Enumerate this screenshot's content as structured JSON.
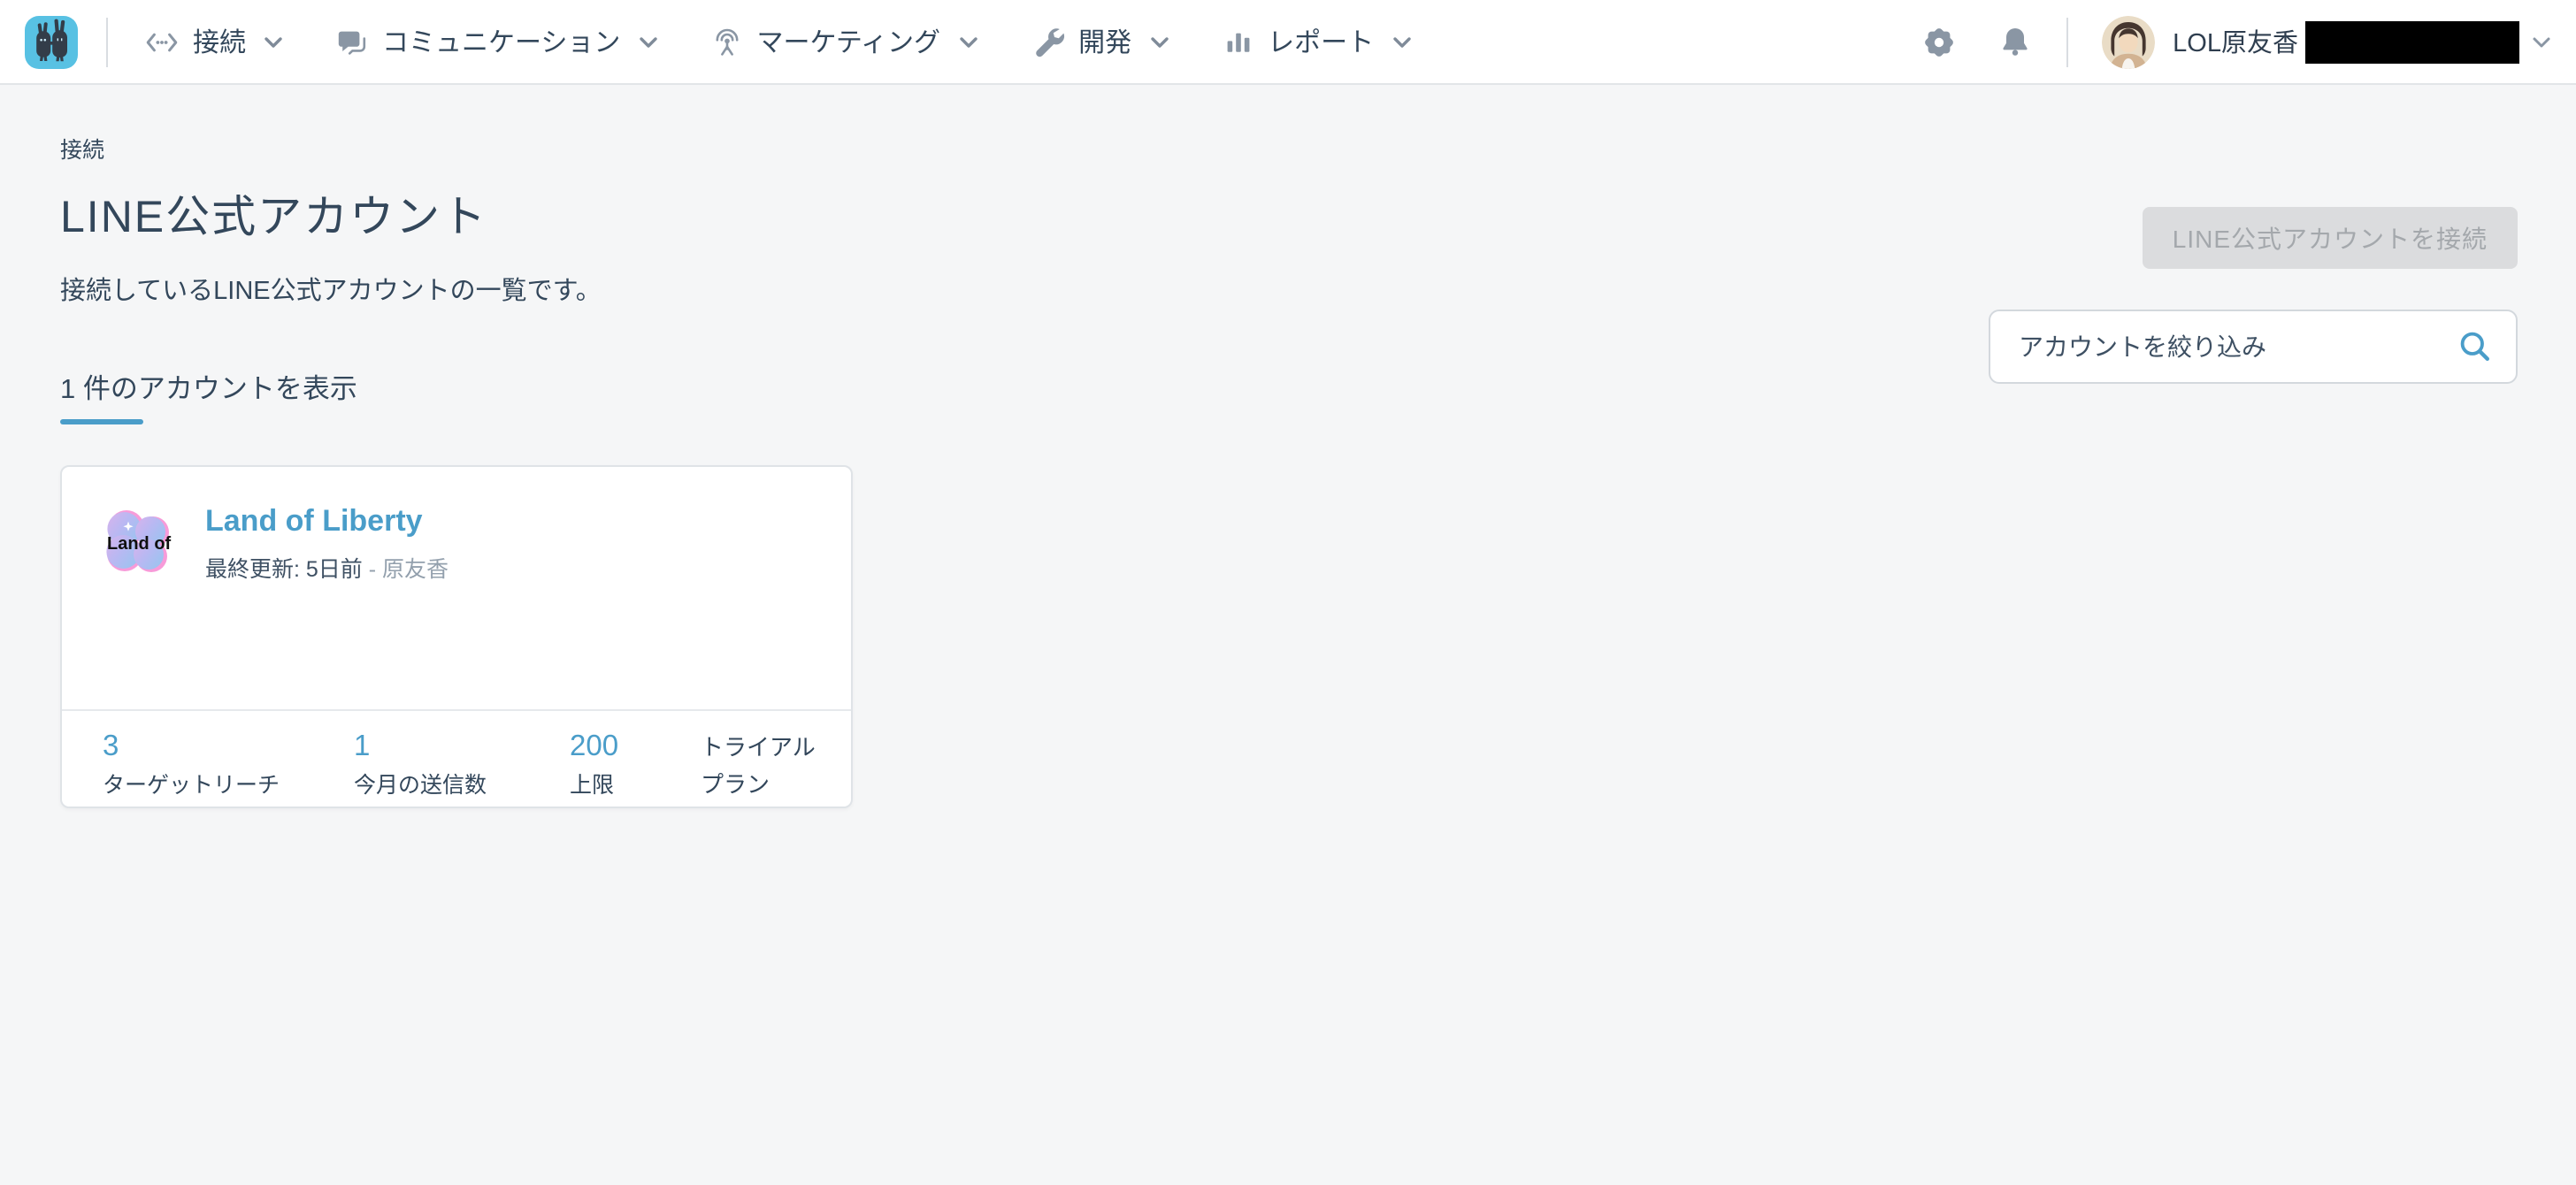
{
  "navbar": {
    "items": [
      {
        "label": "接続",
        "icon": "code-brackets-icon"
      },
      {
        "label": "コミュニケーション",
        "icon": "chat-bubble-icon"
      },
      {
        "label": "マーケティング",
        "icon": "broadcast-antenna-icon"
      },
      {
        "label": "開発",
        "icon": "wrench-icon"
      },
      {
        "label": "レポート",
        "icon": "bar-chart-icon"
      }
    ],
    "right_icons": [
      "gear-icon",
      "bell-icon"
    ],
    "user": {
      "name": "LOL原友香"
    }
  },
  "page": {
    "breadcrumb": "接続",
    "title": "LINE公式アカウント",
    "subtitle": "接続しているLINE公式アカウントの一覧です。",
    "connect_button": "LINE公式アカウントを接続",
    "tab_label": "1 件のアカウントを表示",
    "search_placeholder": "アカウントを絞り込み"
  },
  "account_card": {
    "avatar_text": "Land of",
    "name": "Land of Liberty",
    "last_updated": "最終更新: 5日前",
    "updated_by": "- 原友香",
    "stats": [
      {
        "value": "3",
        "label": "ターゲットリーチ"
      },
      {
        "value": "1",
        "label": "今月の送信数"
      },
      {
        "value": "200",
        "label": "上限"
      },
      {
        "value": "トライアル",
        "label": "プラン"
      }
    ]
  },
  "colors": {
    "accent_blue": "#4a9dc9",
    "text_dark": "#33475b",
    "text_muted": "#93a0ad",
    "logo_cyan": "#58c1e3",
    "page_background": "#f5f6f7",
    "topbar_background": "#ffffff",
    "disabled_button_bg": "#dbdcde"
  }
}
